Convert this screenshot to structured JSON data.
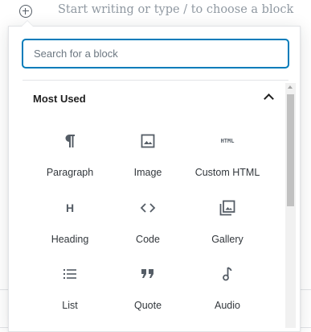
{
  "editor": {
    "placeholder": "Start writing or type / to choose a block"
  },
  "inserter": {
    "search_placeholder": "Search for a block",
    "panel_title": "Most Used",
    "blocks": [
      {
        "label": "Paragraph",
        "icon": "paragraph-icon"
      },
      {
        "label": "Image",
        "icon": "image-icon"
      },
      {
        "label": "Custom HTML",
        "icon": "html-icon"
      },
      {
        "label": "Heading",
        "icon": "heading-icon"
      },
      {
        "label": "Code",
        "icon": "code-icon"
      },
      {
        "label": "Gallery",
        "icon": "gallery-icon"
      },
      {
        "label": "List",
        "icon": "list-icon"
      },
      {
        "label": "Quote",
        "icon": "quote-icon"
      },
      {
        "label": "Audio",
        "icon": "audio-icon"
      }
    ],
    "html_icon_text": "HTML",
    "heading_icon_text": "H"
  },
  "colors": {
    "accent": "#007cba",
    "icon": "#555d66",
    "text": "#32373c",
    "placeholder": "#8f98a1"
  }
}
